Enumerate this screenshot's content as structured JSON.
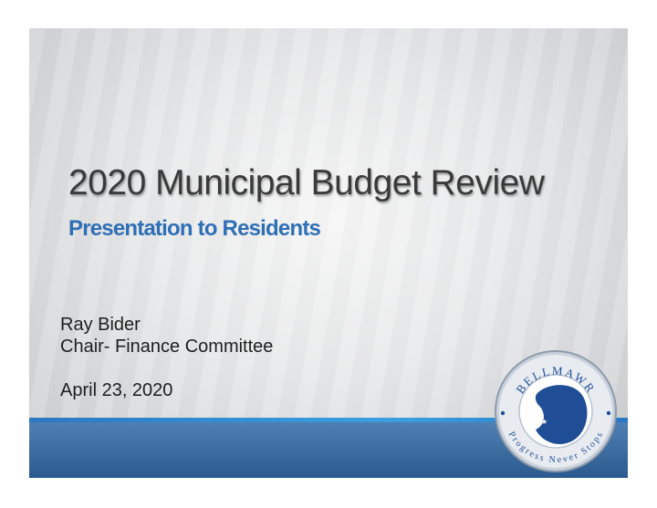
{
  "slide": {
    "title": "2020 Municipal Budget Review",
    "subtitle": "Presentation to Residents",
    "presenter_name": "Ray Bider",
    "presenter_role": "Chair- Finance Committee",
    "date": "April 23, 2020"
  },
  "seal": {
    "icon": "municipal-seal-icon",
    "top_text": "BELLMAWR",
    "bottom_text": "Progress Never Stops"
  },
  "colors": {
    "subtitle": "#2f6fb6",
    "band": "#2b5b8e",
    "seal_blue": "#1f4e97",
    "seal_ring": "#d9dfe8"
  }
}
